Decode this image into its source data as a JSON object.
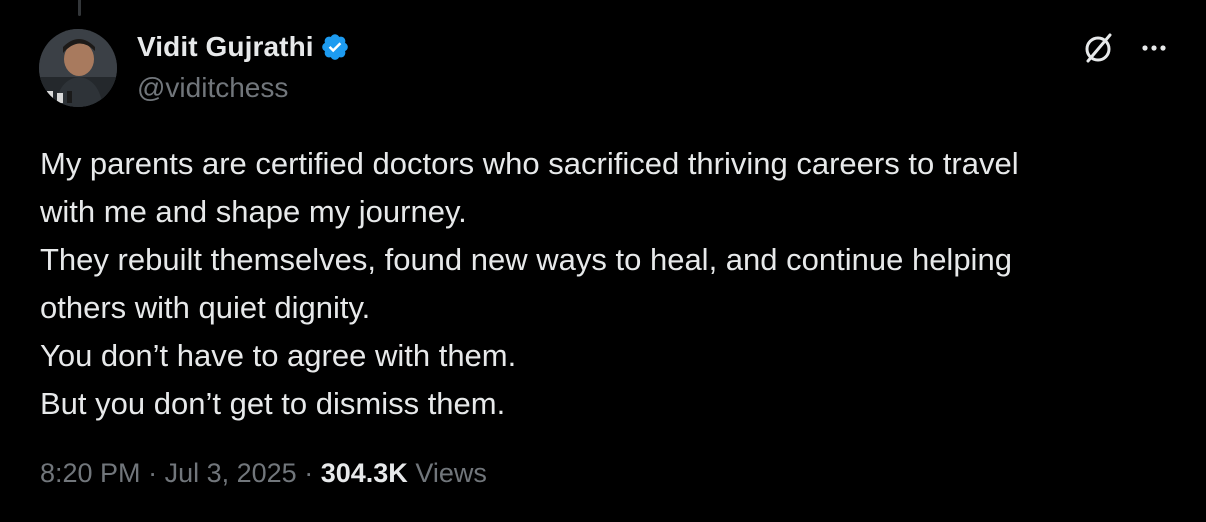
{
  "author": {
    "display_name": "Vidit Gujrathi",
    "handle": "@viditchess",
    "verified": true
  },
  "icons": {
    "verified": "verified-badge-icon",
    "grok": "grok-icon",
    "more": "more-options-icon"
  },
  "colors": {
    "background": "#000000",
    "text": "#e7e9ea",
    "secondary": "#71767b",
    "verified": "#1d9bf0"
  },
  "tweet": {
    "lines": [
      "My parents are certified doctors who sacrificed thriving careers to travel",
      "with me and shape my journey.",
      "They rebuilt themselves, found new ways to heal, and continue helping",
      "others with quiet dignity.",
      "You don’t have to agree with them.",
      "But you don’t get to dismiss them."
    ]
  },
  "meta": {
    "time": "8:20 PM",
    "separator": "·",
    "date": "Jul 3, 2025",
    "views_count": "304.3K",
    "views_label": "Views"
  }
}
